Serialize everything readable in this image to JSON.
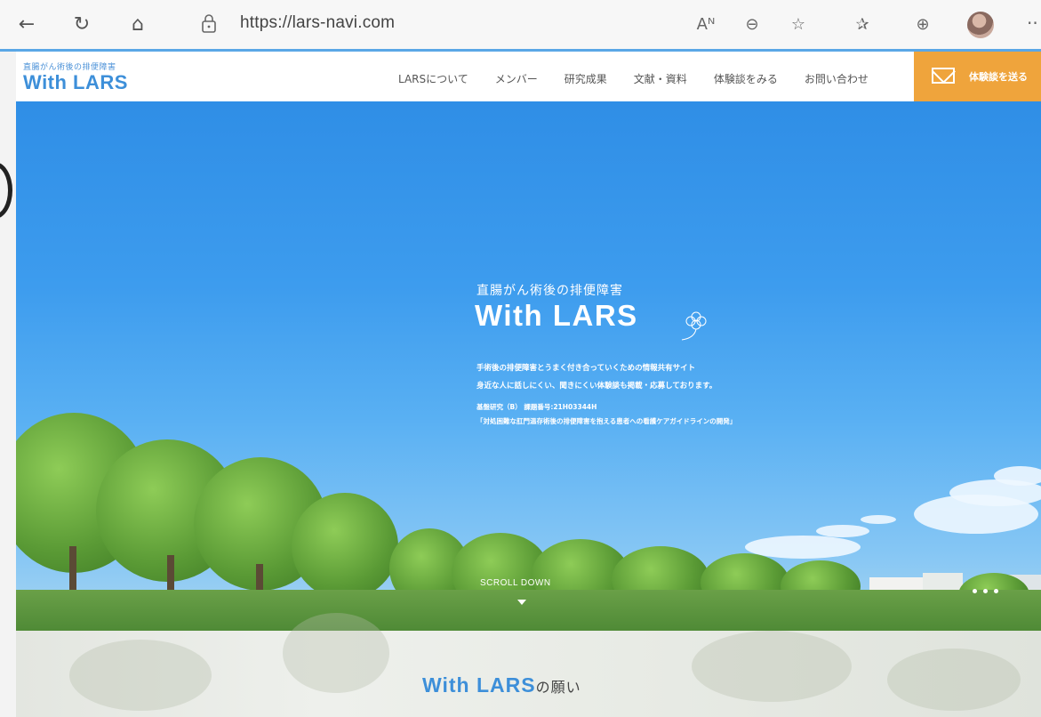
{
  "browser": {
    "url": "https://lars-navi.com",
    "icons": [
      "back-icon",
      "refresh-icon",
      "home-icon",
      "lock-icon",
      "read-aloud-icon",
      "zoom-out-icon",
      "add-favorite-icon",
      "favorites-icon",
      "collections-icon",
      "profile-avatar",
      "more-icon"
    ],
    "read_aloud_glyph": "Aᴺ",
    "more_glyph": "··"
  },
  "site": {
    "logo_sub": "直腸がん術後の排便障害",
    "logo_main": "With LARS",
    "nav": [
      {
        "label": "LARSについて"
      },
      {
        "label": "メンバー"
      },
      {
        "label": "研究成果"
      },
      {
        "label": "文献・資料"
      },
      {
        "label": "体験談をみる"
      },
      {
        "label": "お問い合わせ"
      }
    ],
    "cta_label": "体験談を送る"
  },
  "hero": {
    "subtitle": "直腸がん術後の排便障害",
    "title": "With LARS",
    "desc_line1": "手術後の排便障害とうまく付き合っていくための情報共有サイト",
    "desc_line2": "身近な人に話しにくい、聞きにくい体験談も掲載・応募しております。",
    "ref_line1": "基盤研究（B） 課題番号:21H03344H",
    "ref_line2": "「対処困難な肛門温存術後の排便障害を抱える患者への看護ケアガイドラインの開発」",
    "scroll_label": "SCROLL DOWN",
    "slide_count": 3
  },
  "section": {
    "title": "With LARS",
    "title_suffix": "の願い"
  },
  "colors": {
    "brand_blue": "#3d8fd9",
    "cta_orange": "#efa43c",
    "sky": "#3d9cee"
  }
}
